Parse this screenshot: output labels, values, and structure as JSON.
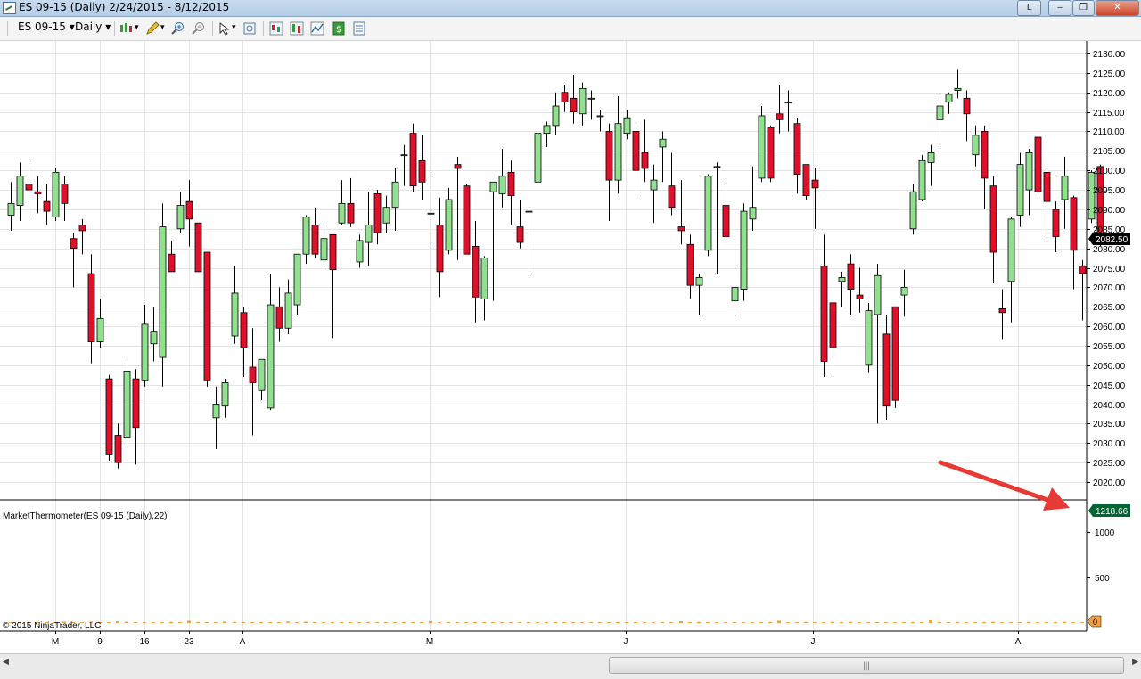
{
  "window": {
    "title": "ES 09-15 (Daily)  2/24/2015 - 8/12/2015",
    "buttons": [
      "L",
      "‒",
      "❐",
      "✕"
    ]
  },
  "toolbar": {
    "instrument": "ES 09-15",
    "period": "Daily"
  },
  "price_panel": {
    "current_price": "2082.50",
    "y_ticks": [
      "2130.00",
      "2125.00",
      "2120.00",
      "2115.00",
      "2110.00",
      "2105.00",
      "2100.00",
      "2095.00",
      "2090.00",
      "2085.00",
      "2080.00",
      "2075.00",
      "2070.00",
      "2065.00",
      "2060.00",
      "2055.00",
      "2050.00",
      "2045.00",
      "2040.00",
      "2035.00",
      "2030.00",
      "2025.00",
      "2020.00"
    ]
  },
  "indicator_panel": {
    "label": "MarketThermometer(ES 09-15 (Daily),22)",
    "current_value": "1218.66",
    "y_ticks": [
      "1000",
      "500"
    ],
    "zero_marker": "0"
  },
  "copyright": "© 2015 NinjaTrader, LLC",
  "x_axis_labels": [
    "M",
    "9",
    "16",
    "23",
    "A",
    "M",
    "J",
    "J",
    "A"
  ],
  "colors": {
    "up": "#90e090",
    "down": "#e0102a",
    "wick": "#000000",
    "indicator": "#f0a040",
    "price_marker": "#000000",
    "indicator_marker": "#006633",
    "arrow": "#e83a35"
  },
  "chart_data": {
    "type": "candlestick",
    "ylim": [
      2018,
      2133
    ],
    "candles": [
      {
        "o": 2088.5,
        "h": 2097.0,
        "l": 2084.5,
        "c": 2091.5
      },
      {
        "o": 2091.0,
        "h": 2102.0,
        "l": 2087.0,
        "c": 2098.5
      },
      {
        "o": 2096.5,
        "h": 2103.0,
        "l": 2088.5,
        "c": 2095.0
      },
      {
        "o": 2094.5,
        "h": 2098.5,
        "l": 2089.0,
        "c": 2094.0
      },
      {
        "o": 2092.0,
        "h": 2096.5,
        "l": 2086.0,
        "c": 2089.5
      },
      {
        "o": 2088.0,
        "h": 2100.5,
        "l": 2087.0,
        "c": 2099.5
      },
      {
        "o": 2096.5,
        "h": 2098.5,
        "l": 2087.0,
        "c": 2091.5
      },
      {
        "o": 2082.5,
        "h": 2084.0,
        "l": 2070.0,
        "c": 2080.0
      },
      {
        "o": 2086.0,
        "h": 2087.5,
        "l": 2078.5,
        "c": 2084.5
      },
      {
        "o": 2073.5,
        "h": 2078.5,
        "l": 2050.5,
        "c": 2056.0
      },
      {
        "o": 2056.0,
        "h": 2067.0,
        "l": 2054.5,
        "c": 2062.0
      },
      {
        "o": 2046.5,
        "h": 2047.5,
        "l": 2025.5,
        "c": 2027.0
      },
      {
        "o": 2032.0,
        "h": 2035.0,
        "l": 2023.5,
        "c": 2025.0
      },
      {
        "o": 2031.5,
        "h": 2050.5,
        "l": 2029.5,
        "c": 2048.5
      },
      {
        "o": 2046.5,
        "h": 2049.0,
        "l": 2024.5,
        "c": 2034.0
      },
      {
        "o": 2046.0,
        "h": 2065.5,
        "l": 2044.5,
        "c": 2060.5
      },
      {
        "o": 2055.5,
        "h": 2065.0,
        "l": 2051.0,
        "c": 2058.5
      },
      {
        "o": 2052.0,
        "h": 2091.5,
        "l": 2044.5,
        "c": 2085.5
      },
      {
        "o": 2078.5,
        "h": 2082.0,
        "l": 2075.0,
        "c": 2074.0
      },
      {
        "o": 2085.0,
        "h": 2094.5,
        "l": 2084.0,
        "c": 2091.0
      },
      {
        "o": 2092.0,
        "h": 2097.5,
        "l": 2080.5,
        "c": 2087.5
      },
      {
        "o": 2086.5,
        "h": 2086.5,
        "l": 2074.5,
        "c": 2074.0
      },
      {
        "o": 2079.0,
        "h": 2079.0,
        "l": 2044.5,
        "c": 2046.0
      },
      {
        "o": 2036.5,
        "h": 2044.5,
        "l": 2028.5,
        "c": 2040.0
      },
      {
        "o": 2039.5,
        "h": 2046.5,
        "l": 2036.5,
        "c": 2045.5
      },
      {
        "o": 2057.5,
        "h": 2075.5,
        "l": 2055.5,
        "c": 2068.5
      },
      {
        "o": 2063.5,
        "h": 2065.0,
        "l": 2047.0,
        "c": 2054.5
      },
      {
        "o": 2049.5,
        "h": 2059.5,
        "l": 2032.0,
        "c": 2045.5
      },
      {
        "o": 2043.5,
        "h": 2049.5,
        "l": 2041.0,
        "c": 2051.5
      },
      {
        "o": 2039.0,
        "h": 2073.5,
        "l": 2038.5,
        "c": 2065.5
      },
      {
        "o": 2065.0,
        "h": 2070.0,
        "l": 2056.0,
        "c": 2059.5
      },
      {
        "o": 2059.5,
        "h": 2072.0,
        "l": 2058.0,
        "c": 2068.5
      },
      {
        "o": 2065.5,
        "h": 2075.0,
        "l": 2063.0,
        "c": 2078.5
      },
      {
        "o": 2078.5,
        "h": 2088.5,
        "l": 2076.0,
        "c": 2088.0
      },
      {
        "o": 2086.0,
        "h": 2090.5,
        "l": 2077.5,
        "c": 2078.5
      },
      {
        "o": 2077.0,
        "h": 2085.5,
        "l": 2074.5,
        "c": 2082.5
      },
      {
        "o": 2083.5,
        "h": 2083.5,
        "l": 2057.0,
        "c": 2074.5
      },
      {
        "o": 2086.5,
        "h": 2097.5,
        "l": 2086.0,
        "c": 2091.5
      },
      {
        "o": 2091.5,
        "h": 2098.0,
        "l": 2085.5,
        "c": 2086.5
      },
      {
        "o": 2076.5,
        "h": 2083.5,
        "l": 2075.0,
        "c": 2082.0
      },
      {
        "o": 2081.5,
        "h": 2094.5,
        "l": 2075.5,
        "c": 2086.0
      },
      {
        "o": 2094.0,
        "h": 2095.0,
        "l": 2081.0,
        "c": 2084.0
      },
      {
        "o": 2086.5,
        "h": 2093.5,
        "l": 2084.0,
        "c": 2090.5
      },
      {
        "o": 2090.5,
        "h": 2100.5,
        "l": 2084.5,
        "c": 2097.0
      },
      {
        "o": 2104.0,
        "h": 2106.5,
        "l": 2096.0,
        "c": 2104.0
      },
      {
        "o": 2109.5,
        "h": 2112.0,
        "l": 2094.5,
        "c": 2096.0
      },
      {
        "o": 2102.5,
        "h": 2109.0,
        "l": 2092.5,
        "c": 2097.0
      },
      {
        "o": 2089.0,
        "h": 2098.5,
        "l": 2080.5,
        "c": 2089.0
      },
      {
        "o": 2086.0,
        "h": 2093.0,
        "l": 2067.5,
        "c": 2074.0
      },
      {
        "o": 2079.5,
        "h": 2095.5,
        "l": 2078.5,
        "c": 2092.5
      },
      {
        "o": 2101.5,
        "h": 2103.5,
        "l": 2077.0,
        "c": 2100.5
      },
      {
        "o": 2096.0,
        "h": 2096.5,
        "l": 2079.0,
        "c": 2078.5
      },
      {
        "o": 2080.5,
        "h": 2087.0,
        "l": 2061.0,
        "c": 2067.5
      },
      {
        "o": 2067.0,
        "h": 2078.0,
        "l": 2061.5,
        "c": 2077.5
      },
      {
        "o": 2094.5,
        "h": 2096.0,
        "l": 2066.5,
        "c": 2097.0
      },
      {
        "o": 2094.0,
        "h": 2105.5,
        "l": 2090.5,
        "c": 2098.5
      },
      {
        "o": 2099.5,
        "h": 2102.5,
        "l": 2086.0,
        "c": 2093.5
      },
      {
        "o": 2085.5,
        "h": 2092.5,
        "l": 2080.0,
        "c": 2081.5
      },
      {
        "o": 2089.5,
        "h": 2090.0,
        "l": 2073.5,
        "c": 2089.5
      },
      {
        "o": 2097.0,
        "h": 2110.5,
        "l": 2096.5,
        "c": 2109.5
      },
      {
        "o": 2109.5,
        "h": 2112.5,
        "l": 2106.0,
        "c": 2111.5
      },
      {
        "o": 2111.5,
        "h": 2120.0,
        "l": 2109.0,
        "c": 2116.5
      },
      {
        "o": 2120.0,
        "h": 2122.0,
        "l": 2115.0,
        "c": 2117.5
      },
      {
        "o": 2118.5,
        "h": 2124.5,
        "l": 2112.0,
        "c": 2115.0
      },
      {
        "o": 2114.5,
        "h": 2122.5,
        "l": 2111.5,
        "c": 2121.0
      },
      {
        "o": 2118.5,
        "h": 2120.5,
        "l": 2113.0,
        "c": 2118.5
      },
      {
        "o": 2114.0,
        "h": 2115.5,
        "l": 2110.0,
        "c": 2114.0
      },
      {
        "o": 2110.0,
        "h": 2112.0,
        "l": 2087.0,
        "c": 2097.5
      },
      {
        "o": 2097.5,
        "h": 2119.0,
        "l": 2094.0,
        "c": 2112.0
      },
      {
        "o": 2109.5,
        "h": 2115.5,
        "l": 2108.0,
        "c": 2113.5
      },
      {
        "o": 2110.0,
        "h": 2112.5,
        "l": 2094.0,
        "c": 2100.0
      },
      {
        "o": 2104.5,
        "h": 2113.0,
        "l": 2097.0,
        "c": 2100.5
      },
      {
        "o": 2095.0,
        "h": 2101.5,
        "l": 2086.5,
        "c": 2097.5
      },
      {
        "o": 2106.0,
        "h": 2110.0,
        "l": 2097.0,
        "c": 2108.0
      },
      {
        "o": 2096.0,
        "h": 2104.5,
        "l": 2088.5,
        "c": 2090.5
      },
      {
        "o": 2085.5,
        "h": 2097.5,
        "l": 2081.0,
        "c": 2084.5
      },
      {
        "o": 2081.0,
        "h": 2083.5,
        "l": 2067.0,
        "c": 2070.5
      },
      {
        "o": 2070.5,
        "h": 2073.5,
        "l": 2063.0,
        "c": 2072.5
      },
      {
        "o": 2079.5,
        "h": 2099.0,
        "l": 2078.0,
        "c": 2098.5
      },
      {
        "o": 2101.0,
        "h": 2102.0,
        "l": 2073.5,
        "c": 2101.0
      },
      {
        "o": 2091.0,
        "h": 2097.5,
        "l": 2081.5,
        "c": 2083.0
      },
      {
        "o": 2066.5,
        "h": 2074.5,
        "l": 2062.5,
        "c": 2070.0
      },
      {
        "o": 2069.5,
        "h": 2091.5,
        "l": 2066.5,
        "c": 2089.5
      },
      {
        "o": 2087.5,
        "h": 2101.0,
        "l": 2084.5,
        "c": 2090.5
      },
      {
        "o": 2098.0,
        "h": 2116.5,
        "l": 2097.0,
        "c": 2114.0
      },
      {
        "o": 2111.0,
        "h": 2111.5,
        "l": 2097.0,
        "c": 2098.0
      },
      {
        "o": 2114.5,
        "h": 2122.0,
        "l": 2109.5,
        "c": 2113.0
      },
      {
        "o": 2117.5,
        "h": 2120.5,
        "l": 2110.0,
        "c": 2117.5
      },
      {
        "o": 2112.0,
        "h": 2113.5,
        "l": 2094.0,
        "c": 2099.0
      },
      {
        "o": 2101.5,
        "h": 2101.5,
        "l": 2092.5,
        "c": 2093.5
      },
      {
        "o": 2097.5,
        "h": 2100.5,
        "l": 2085.0,
        "c": 2095.5
      },
      {
        "o": 2075.5,
        "h": 2083.5,
        "l": 2047.0,
        "c": 2051.0
      },
      {
        "o": 2066.0,
        "h": 2066.0,
        "l": 2047.5,
        "c": 2054.5
      },
      {
        "o": 2071.5,
        "h": 2074.0,
        "l": 2065.0,
        "c": 2072.5
      },
      {
        "o": 2076.0,
        "h": 2078.5,
        "l": 2063.0,
        "c": 2069.5
      },
      {
        "o": 2068.0,
        "h": 2075.0,
        "l": 2063.5,
        "c": 2067.0
      },
      {
        "o": 2050.0,
        "h": 2066.0,
        "l": 2048.0,
        "c": 2064.0
      },
      {
        "o": 2063.0,
        "h": 2076.0,
        "l": 2035.0,
        "c": 2073.0
      },
      {
        "o": 2058.0,
        "h": 2063.0,
        "l": 2036.0,
        "c": 2039.5
      },
      {
        "o": 2065.0,
        "h": 2065.0,
        "l": 2039.0,
        "c": 2041.0
      },
      {
        "o": 2068.0,
        "h": 2074.5,
        "l": 2062.5,
        "c": 2070.0
      },
      {
        "o": 2085.0,
        "h": 2096.5,
        "l": 2083.5,
        "c": 2094.5
      },
      {
        "o": 2092.5,
        "h": 2104.0,
        "l": 2092.0,
        "c": 2102.5
      },
      {
        "o": 2102.0,
        "h": 2106.5,
        "l": 2096.0,
        "c": 2104.5
      },
      {
        "o": 2113.0,
        "h": 2119.5,
        "l": 2106.0,
        "c": 2116.5
      },
      {
        "o": 2117.5,
        "h": 2120.0,
        "l": 2114.5,
        "c": 2119.5
      },
      {
        "o": 2120.5,
        "h": 2126.0,
        "l": 2118.5,
        "c": 2121.0
      },
      {
        "o": 2118.5,
        "h": 2120.5,
        "l": 2107.5,
        "c": 2114.5
      },
      {
        "o": 2104.0,
        "h": 2111.5,
        "l": 2101.0,
        "c": 2109.0
      },
      {
        "o": 2110.0,
        "h": 2111.5,
        "l": 2090.0,
        "c": 2098.0
      },
      {
        "o": 2096.0,
        "h": 2098.5,
        "l": 2071.0,
        "c": 2079.0
      },
      {
        "o": 2064.5,
        "h": 2069.5,
        "l": 2056.5,
        "c": 2063.5
      },
      {
        "o": 2071.5,
        "h": 2088.0,
        "l": 2061.0,
        "c": 2087.5
      },
      {
        "o": 2088.5,
        "h": 2104.5,
        "l": 2085.5,
        "c": 2101.5
      },
      {
        "o": 2095.0,
        "h": 2105.5,
        "l": 2088.5,
        "c": 2104.5
      },
      {
        "o": 2108.5,
        "h": 2109.0,
        "l": 2093.5,
        "c": 2094.5
      },
      {
        "o": 2099.5,
        "h": 2100.0,
        "l": 2082.0,
        "c": 2092.0
      },
      {
        "o": 2090.0,
        "h": 2092.0,
        "l": 2079.0,
        "c": 2083.0
      },
      {
        "o": 2092.5,
        "h": 2103.5,
        "l": 2085.0,
        "c": 2098.5
      },
      {
        "o": 2093.0,
        "h": 2093.5,
        "l": 2069.5,
        "c": 2079.5
      },
      {
        "o": 2075.5,
        "h": 2077.0,
        "l": 2061.5,
        "c": 2073.5
      },
      {
        "o": 2087.5,
        "h": 2100.0,
        "l": 2086.5,
        "c": 2099.5
      },
      {
        "o": 2101.0,
        "h": 2101.5,
        "l": 2080.5,
        "c": 2082.5
      }
    ],
    "indicator_values": [
      10,
      5,
      5,
      5,
      5,
      5,
      15,
      12,
      8,
      15,
      12,
      10,
      20,
      15,
      5,
      5,
      5,
      10,
      12,
      5,
      25,
      5,
      5,
      5,
      15,
      12,
      12,
      8,
      5,
      5,
      5,
      15,
      5,
      15,
      10,
      5,
      5,
      5,
      5,
      5,
      12,
      5,
      5,
      5,
      5,
      5,
      5,
      20,
      8,
      5,
      8,
      5,
      5,
      5,
      5,
      5,
      5,
      5,
      5,
      5,
      5,
      5,
      5,
      5,
      5,
      5,
      5,
      5,
      5,
      5,
      5,
      5,
      5,
      5,
      5,
      20,
      5,
      12,
      5,
      5,
      5,
      5,
      5,
      5,
      5,
      5,
      25,
      5,
      5,
      12,
      5,
      5,
      12,
      5,
      12,
      5,
      5,
      5,
      5,
      5,
      5,
      5,
      5,
      30,
      5,
      5,
      12,
      5,
      5,
      5,
      12,
      5,
      5,
      5,
      12,
      5,
      5,
      5,
      12,
      5,
      5,
      5
    ],
    "indicator_max": 1218.66
  }
}
